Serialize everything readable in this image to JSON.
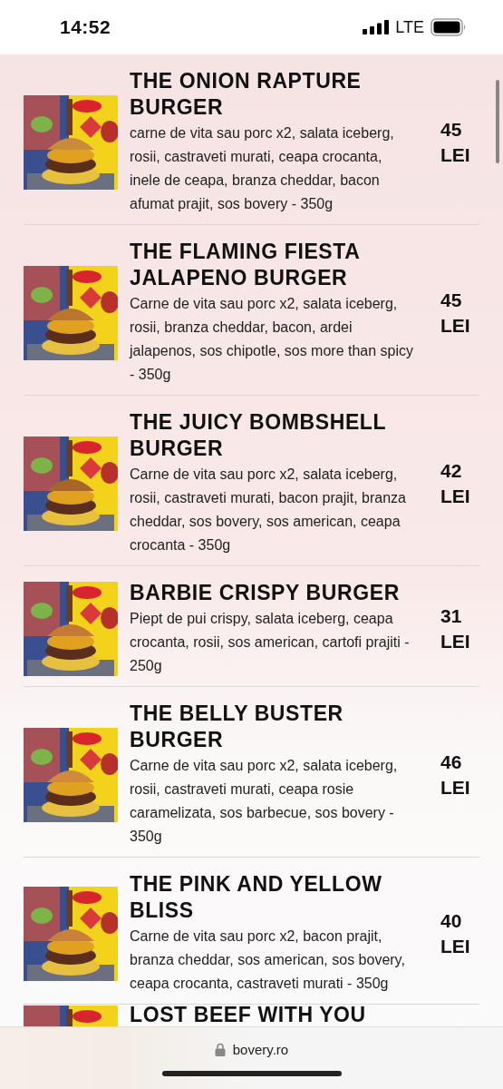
{
  "status_bar": {
    "time": "14:52",
    "network": "LTE"
  },
  "menu_items": [
    {
      "title": "THE ONION RAPTURE BURGER",
      "description": "carne de vita sau porc x2, salata iceberg, rosii, castraveti murati, ceapa crocanta, inele de ceapa, branza cheddar, bacon afumat prajit, sos bovery - 350g",
      "price": "45 LEI"
    },
    {
      "title": "THE FLAMING FIESTA JALAPENO BURGER",
      "description": "Carne de vita sau porc x2, salata iceberg, rosii, branza cheddar, bacon, ardei jalapenos, sos chipotle, sos more than spicy - 350g",
      "price": "45 LEI"
    },
    {
      "title": "THE JUICY BOMBSHELL BURGER",
      "description": "Carne de vita sau porc x2, salata iceberg, rosii, castraveti murati, bacon prajit, branza cheddar, sos bovery, sos american, ceapa crocanta - 350g",
      "price": "42 LEI"
    },
    {
      "title": "BARBIE CRISPY BURGER",
      "description": "Piept de pui crispy, salata iceberg, ceapa crocanta, rosii, sos american, cartofi prajiti - 250g",
      "price": "31 LEI"
    },
    {
      "title": "THE BELLY BUSTER BURGER",
      "description": "Carne de vita sau porc x2, salata iceberg, rosii, castraveti murati, ceapa rosie caramelizata, sos barbecue, sos bovery - 350g",
      "price": "46 LEI"
    },
    {
      "title": "THE PINK AND YELLOW BLISS",
      "description": "Carne de vita sau porc x2, bacon prajit, branza cheddar, sos american, sos bovery, ceapa crocanta, castraveti murati - 350g",
      "price": "40 LEI"
    },
    {
      "title": "LOST BEEF WITH YOU"
    }
  ],
  "browser_bar": {
    "url": "bovery.ro"
  }
}
